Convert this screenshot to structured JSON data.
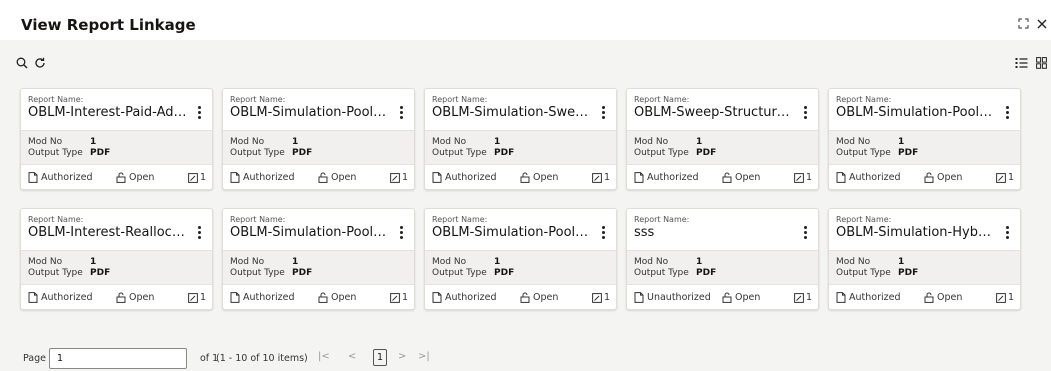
{
  "header": {
    "title": "View Report Linkage",
    "icons": [
      "expand-icon",
      "close-icon"
    ]
  },
  "toolbar": {
    "left_icons": [
      "search-icon",
      "refresh-icon"
    ],
    "right_icons": [
      "list-view-icon",
      "grid-view-icon"
    ]
  },
  "card_labels": {
    "report_name": "Report Name:",
    "mod_no": "Mod No",
    "output_type": "Output Type"
  },
  "cards": [
    {
      "name": "OBLM-Interest-Paid-Advice",
      "mod_no": "1",
      "output_type": "PDF",
      "status": "Authorized",
      "lock": "Open",
      "edits": "1"
    },
    {
      "name": "OBLM-Simulation-Pool-IO...",
      "mod_no": "1",
      "output_type": "PDF",
      "status": "Authorized",
      "lock": "Open",
      "edits": "1"
    },
    {
      "name": "OBLM-Simulation-Sweep-...",
      "mod_no": "1",
      "output_type": "PDF",
      "status": "Authorized",
      "lock": "Open",
      "edits": "1"
    },
    {
      "name": "OBLM-Sweep-Structure-A...",
      "mod_no": "1",
      "output_type": "PDF",
      "status": "Authorized",
      "lock": "Open",
      "edits": "1"
    },
    {
      "name": "OBLM-Simulation-Pool-A...",
      "mod_no": "1",
      "output_type": "PDF",
      "status": "Authorized",
      "lock": "Open",
      "edits": "1"
    },
    {
      "name": "OBLM-Interest-Reallocati...",
      "mod_no": "1",
      "output_type": "PDF",
      "status": "Authorized",
      "lock": "Open",
      "edits": "1"
    },
    {
      "name": "OBLM-Simulation-Pool-R...",
      "mod_no": "1",
      "output_type": "PDF",
      "status": "Authorized",
      "lock": "Open",
      "edits": "1"
    },
    {
      "name": "OBLM-Simulation-Pool-A...",
      "mod_no": "1",
      "output_type": "PDF",
      "status": "Authorized",
      "lock": "Open",
      "edits": "1"
    },
    {
      "name": "sss",
      "mod_no": "1",
      "output_type": "PDF",
      "status": "Unauthorized",
      "lock": "Open",
      "edits": "1"
    },
    {
      "name": "OBLM-Simulation-Hybrid...",
      "mod_no": "1",
      "output_type": "PDF",
      "status": "Authorized",
      "lock": "Open",
      "edits": "1"
    }
  ],
  "pager": {
    "page_label": "Page",
    "page_value": "1",
    "of_label": "of 1",
    "items_label": "(1 - 10 of 10 items)",
    "current_page": "1",
    "nav_first": "|<",
    "nav_prev": "<",
    "nav_next": ">",
    "nav_last": ">|"
  }
}
